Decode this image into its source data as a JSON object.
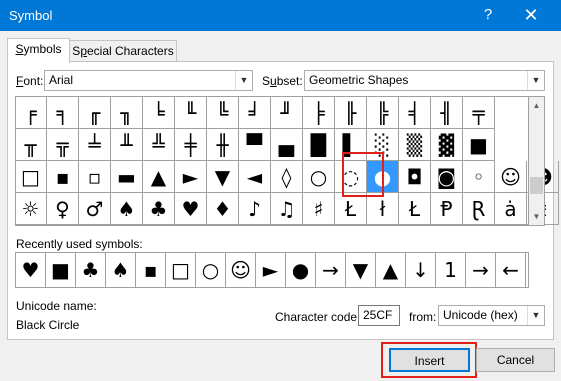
{
  "window": {
    "title": "Symbol",
    "help_label": "?",
    "close_label": "✕"
  },
  "tabs": [
    {
      "label_prefix": "",
      "label_u": "S",
      "label_rest": "ymbols"
    },
    {
      "label_prefix": "S",
      "label_u": "p",
      "label_rest": "ecial Characters"
    }
  ],
  "font": {
    "label_u": "F",
    "label_rest": "ont:",
    "value": "Arial"
  },
  "subset": {
    "label_u": "",
    "label_pre": "S",
    "label_rest": "u",
    "label_full": "Subset:",
    "value": "Geometric Shapes"
  },
  "grid": {
    "rows": [
      [
        "╒",
        "╕",
        "╓",
        "╖",
        "╘",
        "╙",
        "╚",
        "╛",
        "╜",
        "╞",
        "╟",
        "╠",
        "╡",
        "╢",
        "╤"
      ],
      [
        "╥",
        "╦",
        "╧",
        "╨",
        "╩",
        "╪",
        "╫",
        "▀",
        "▄",
        "█",
        "▌",
        "░",
        "▒",
        "▓",
        "■"
      ],
      [
        "□",
        "▪",
        "▫",
        "▬",
        "▲",
        "►",
        "▼",
        "◄",
        "◊",
        "○",
        "◌",
        "●",
        "◘",
        "◙",
        "◦",
        "☺",
        "☻"
      ],
      [
        "☼",
        "♀",
        "♂",
        "♠",
        "♣",
        "♥",
        "♦",
        "♪",
        "♫",
        "♯",
        "Ł",
        "ł",
        "Ł",
        "Ᵽ",
        "Ɽ",
        "ȧ",
        "ŧ"
      ]
    ],
    "selected": "●"
  },
  "recent": {
    "label": "Recently used symbols:",
    "symbols": [
      "♥",
      "■",
      "♣",
      "♠",
      "▪",
      "□",
      "○",
      "☺",
      "►",
      "●",
      "→",
      "▼",
      "▲",
      "↓",
      "1",
      "→",
      "←"
    ]
  },
  "unicode": {
    "name_label": "Unicode name:",
    "name_value": "Black Circle"
  },
  "charcode": {
    "label": "Character code:",
    "value": "25CF",
    "from_label": "from:",
    "from_value": "Unicode (hex)"
  },
  "buttons": {
    "insert": "Insert",
    "cancel": "Cancel"
  }
}
